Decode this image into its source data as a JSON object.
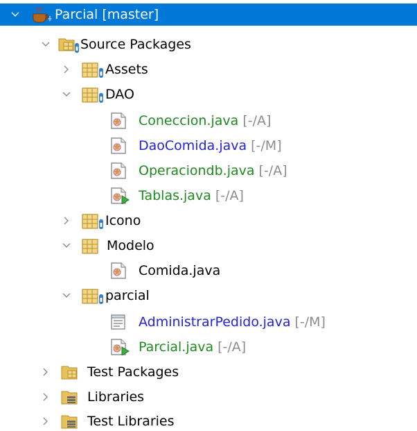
{
  "project": {
    "label": "Parcial [master]",
    "icon": "java-project-icon",
    "state": "expanded",
    "colors": {
      "selection": "#0078d7",
      "selection_text": "#ffffff"
    }
  },
  "source_packages": {
    "label": "Source Packages",
    "icon": "source-packages-folder-icon",
    "state": "expanded"
  },
  "packages": {
    "assets": {
      "label": "Assets",
      "icon": "package-icon",
      "state": "collapsed"
    },
    "dao": {
      "label": "DAO",
      "icon": "package-icon",
      "state": "expanded"
    },
    "icono": {
      "label": "Icono",
      "icon": "package-icon",
      "state": "collapsed"
    },
    "modelo": {
      "label": "Modelo",
      "icon": "package-icon",
      "state": "expanded"
    },
    "parcial": {
      "label": "parcial",
      "icon": "package-icon",
      "state": "expanded"
    }
  },
  "files": {
    "coneccion": {
      "label": "Coneccion.java",
      "status": "[-/A]",
      "icon": "java-class-icon",
      "color": "#1e8a1e"
    },
    "daocomida": {
      "label": "DaoComida.java",
      "status": "[-/M]",
      "icon": "java-class-icon",
      "color": "#2222dd"
    },
    "operaciondb": {
      "label": "Operaciondb.java",
      "status": "[-/A]",
      "icon": "java-class-icon",
      "color": "#1e8a1e"
    },
    "tablas": {
      "label": "Tablas.java",
      "status": "[-/A]",
      "icon": "java-main-class-icon",
      "color": "#1e8a1e"
    },
    "comida": {
      "label": "Comida.java",
      "status": "",
      "icon": "java-class-icon",
      "color": "#000000"
    },
    "administrarpedido": {
      "label": "AdministrarPedido.java",
      "status": "[-/M]",
      "icon": "java-form-icon",
      "color": "#2222dd"
    },
    "parcial_java": {
      "label": "Parcial.java",
      "status": "[-/A]",
      "icon": "java-main-class-icon",
      "color": "#1e8a1e"
    }
  },
  "bottom_nodes": {
    "test_packages": {
      "label": "Test Packages",
      "icon": "test-packages-folder-icon",
      "state": "collapsed"
    },
    "libraries": {
      "label": "Libraries",
      "icon": "libraries-folder-icon",
      "state": "collapsed"
    },
    "test_libraries": {
      "label": "Test Libraries",
      "icon": "test-libraries-folder-icon",
      "state": "collapsed"
    }
  }
}
